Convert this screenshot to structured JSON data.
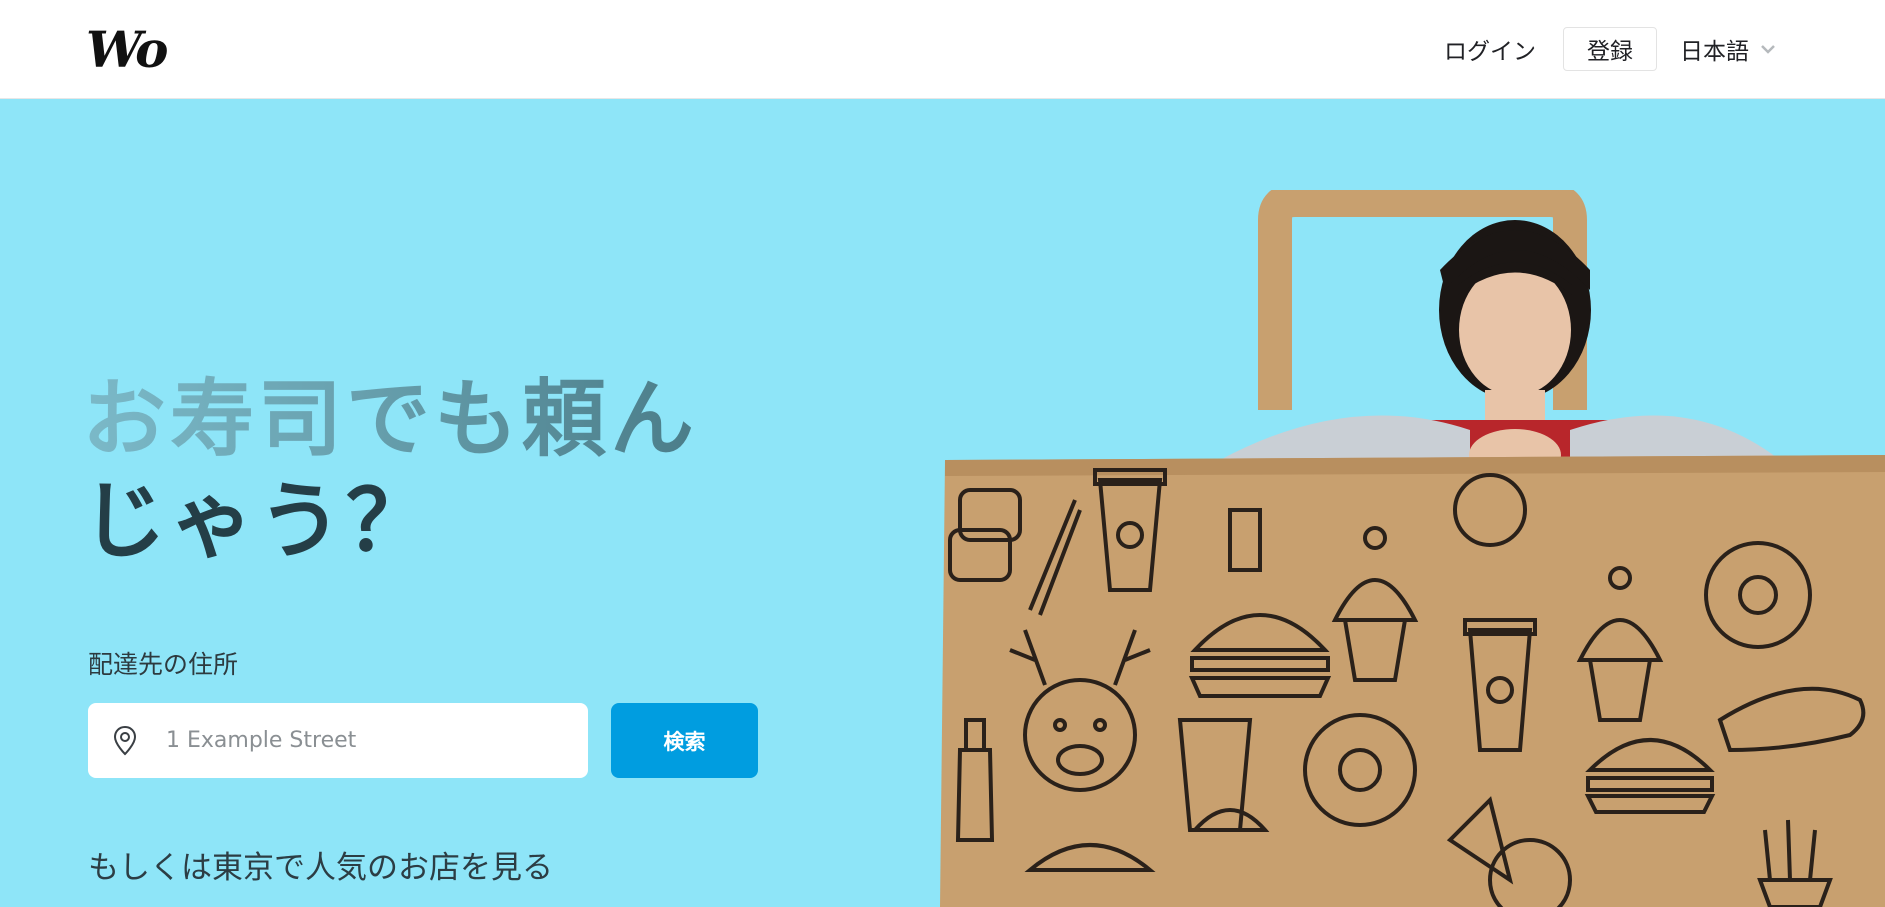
{
  "header": {
    "logo": "Wo",
    "login_label": "ログイン",
    "register_label": "登録",
    "language_label": "日本語",
    "chevron_icon": "chevron-down-icon"
  },
  "hero": {
    "headline_line1": "お寿司でも頼ん",
    "headline_line2": "じゃう？",
    "address_label": "配達先の住所",
    "address_placeholder": "1 Example Street",
    "location_icon": "location-pin-icon",
    "search_label": "検索",
    "popular_link": "もしくは東京で人気のお店を見る"
  },
  "colors": {
    "background": "#8ee5f8",
    "accent": "#009de0",
    "bag": "#c8a06f"
  }
}
